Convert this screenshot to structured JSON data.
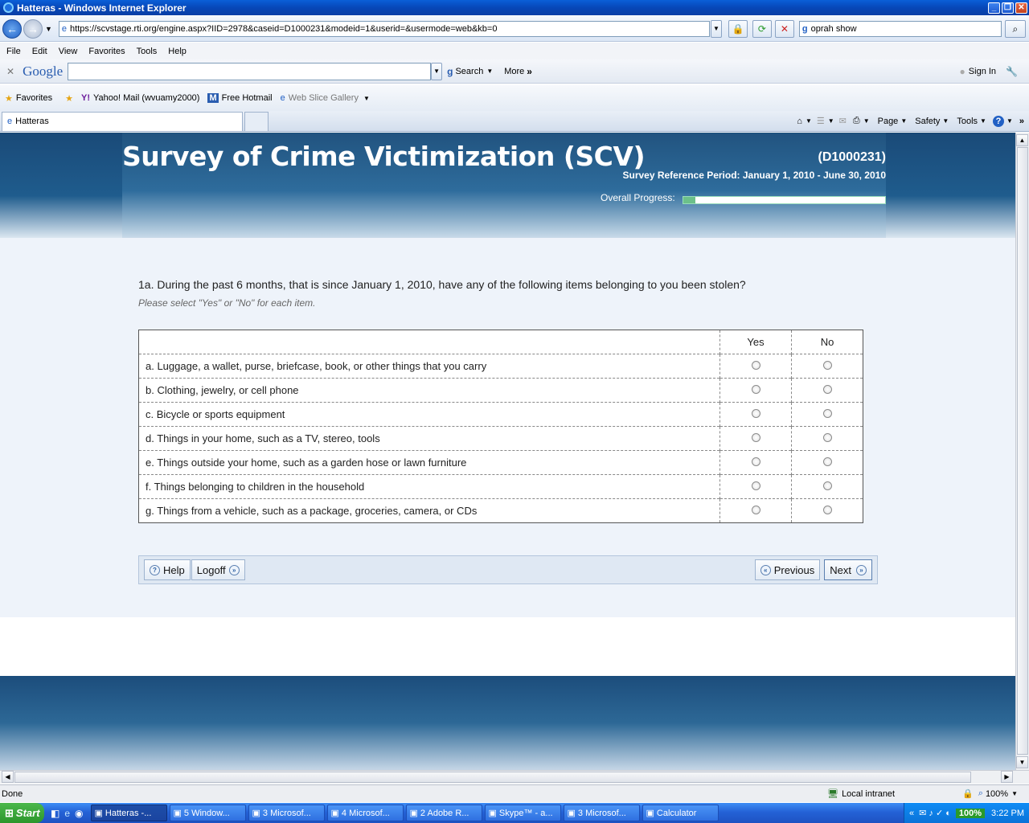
{
  "window": {
    "title": "Hatteras - Windows Internet Explorer"
  },
  "address": {
    "url": "https://scvstage.rti.org/engine.aspx?IID=2978&caseid=D1000231&modeid=1&userid=&usermode=web&kb=0",
    "search_value": "oprah show"
  },
  "menu": {
    "items": [
      "File",
      "Edit",
      "View",
      "Favorites",
      "Tools",
      "Help"
    ]
  },
  "googlebar": {
    "logo": "Google",
    "search_label": "Search",
    "more_label": "More",
    "signin_label": "Sign In"
  },
  "favorites": {
    "label": "Favorites",
    "items": [
      "Yahoo! Mail (wvuamy2000)",
      "Free Hotmail",
      "Web Slice Gallery"
    ]
  },
  "tab": {
    "title": "Hatteras"
  },
  "commandbar": {
    "page": "Page",
    "safety": "Safety",
    "tools": "Tools"
  },
  "survey": {
    "title": "Survey of Crime Victimization (SCV)",
    "caseid": "(D1000231)",
    "reference_period": "Survey Reference Period: January 1, 2010 - June 30, 2010",
    "progress_label": "Overall Progress:",
    "progress": 0.06,
    "question": "1a. During the past 6 months, that is since January 1, 2010, have any of the following items belonging to you been stolen?",
    "instruction": "Please select \"Yes\" or \"No\" for each item.",
    "col_yes": "Yes",
    "col_no": "No",
    "items": [
      "a. Luggage, a wallet, purse, briefcase, book, or other things that you carry",
      "b. Clothing, jewelry, or cell phone",
      "c. Bicycle or sports equipment",
      "d. Things in your home, such as a TV, stereo, tools",
      "e. Things outside your home, such as a garden hose or lawn furniture",
      "f. Things belonging to children in the household",
      "g. Things from a vehicle, such as a package, groceries, camera, or CDs"
    ],
    "buttons": {
      "help": "Help",
      "logoff": "Logoff",
      "previous": "Previous",
      "next": "Next"
    }
  },
  "status": {
    "text": "Done",
    "zone": "Local intranet",
    "zoom": "100%"
  },
  "taskbar": {
    "start": "Start",
    "tasks": [
      "Hatteras -...",
      "5 Window...",
      "3 Microsof...",
      "4 Microsof...",
      "2 Adobe R...",
      "Skype™ - a...",
      "3 Microsof...",
      "Calculator"
    ],
    "battery": "100%",
    "clock": "3:22 PM"
  }
}
